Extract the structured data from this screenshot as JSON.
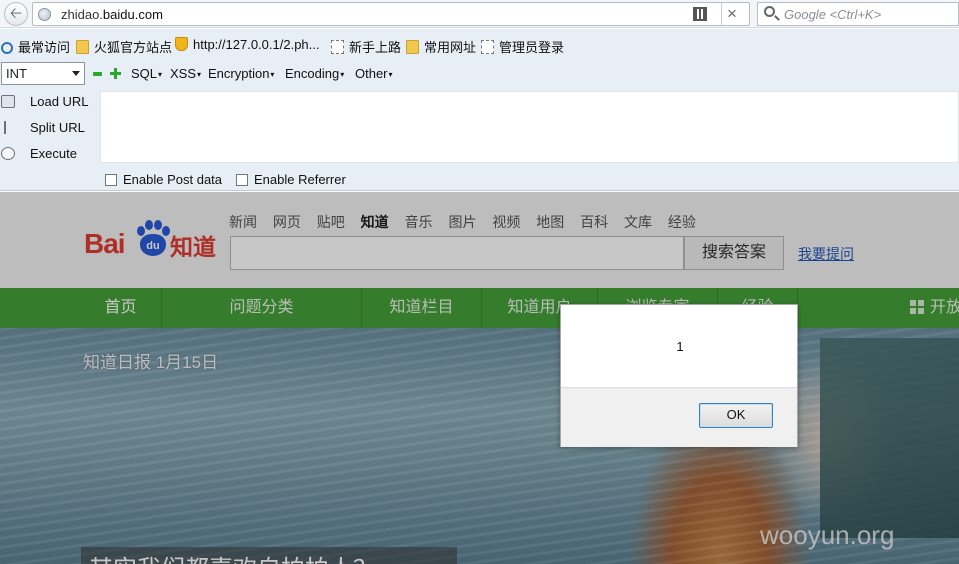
{
  "browser": {
    "url_host_prefix": "zhidao.",
    "url_host_domain": "baidu.com",
    "search_placeholder": "Google <Ctrl+K>",
    "stop_glyph": "×",
    "back_glyph": "🡠"
  },
  "bookmarks": [
    {
      "label": "最常访问",
      "icon": "search-icon"
    },
    {
      "label": "火狐官方站点",
      "icon": "folder-icon"
    },
    {
      "label": "http://127.0.0.1/2.ph...",
      "icon": "trophy-icon"
    },
    {
      "label": "新手上路",
      "icon": "page-icon"
    },
    {
      "label": "常用网址",
      "icon": "folder-icon"
    },
    {
      "label": "管理员登录",
      "icon": "page-icon"
    }
  ],
  "hackbar": {
    "select_value": "INT",
    "menus": [
      "SQL",
      "XSS",
      "Encryption",
      "Encoding",
      "Other"
    ],
    "load_url": "Load URL",
    "split_url": "Split URL",
    "execute": "Execute",
    "enable_post": "Enable Post data",
    "enable_referrer": "Enable Referrer"
  },
  "site": {
    "logo_bai": "Bai",
    "logo_du": "du",
    "logo_zhidao": "知道",
    "top_nav": [
      "新闻",
      "网页",
      "贴吧",
      "知道",
      "音乐",
      "图片",
      "视频",
      "地图",
      "百科",
      "文库",
      "经验"
    ],
    "active_nav": "知道",
    "search_button": "搜索答案",
    "ask_link": "我要提问",
    "green_nav": [
      "首页",
      "问题分类",
      "知道栏目",
      "知道用户",
      "浏览专家",
      "经验",
      "开放"
    ],
    "daily": "知道日报 1月15日",
    "question": "其实我们都喜欢自拍拍人？",
    "watermark": "wooyun.org"
  },
  "dialog": {
    "message": "1",
    "ok_label": "OK"
  },
  "colors": {
    "baidu_red": "#e13b33",
    "baidu_blue": "#2a5bd7",
    "nav_green": "#45a03a",
    "toolbar_bg": "#e8eef6"
  }
}
